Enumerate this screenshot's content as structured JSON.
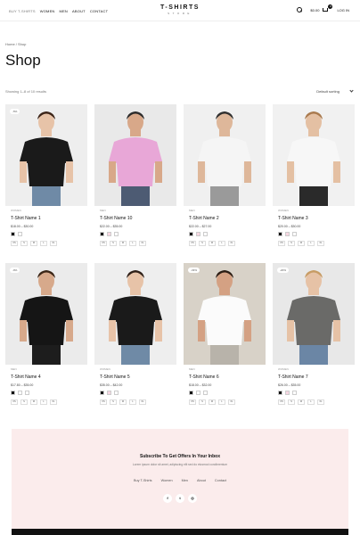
{
  "header": {
    "nav": [
      "BUY T-SHIRTS",
      "WOMEN",
      "MEN",
      "ABOUT",
      "CONTACT"
    ],
    "logo_main": "T-SHIRTS",
    "logo_sub": "STORE",
    "cart_total": "$0.00",
    "cart_count": "0",
    "login": "LOG IN"
  },
  "breadcrumb": "Home / Shop",
  "title": "Shop",
  "results": "Showing 1–8 of 10 results",
  "sort": "Default sorting",
  "products": [
    {
      "discount": "-5%",
      "category": "Women",
      "name": "T-Shirt Name 1",
      "price": "$18.00 – $30.00",
      "swatches": [
        "#111111",
        "#ffffff"
      ],
      "sizes": [
        "XS",
        "S",
        "M",
        "L",
        "XL"
      ],
      "bg": "#eeeeee",
      "shirt": "#1a1a1a",
      "skin": "#e7c3a8",
      "hair": "#3b2418",
      "legs": "#6f8aa6"
    },
    {
      "discount": "",
      "category": "Men",
      "name": "T-Shirt Name 10",
      "price": "$22.00 – $35.00",
      "swatches": [
        "#111111",
        "#f6d6e2",
        "#ffffff"
      ],
      "sizes": [
        "XS",
        "S",
        "M",
        "L",
        "XL"
      ],
      "bg": "#e9e9e9",
      "shirt": "#e8a7d7",
      "skin": "#d8a889",
      "hair": "#2b2b2b",
      "legs": "#4d5b73"
    },
    {
      "discount": "",
      "category": "Men",
      "name": "T-Shirt Name 2",
      "price": "$22.00 – $27.00",
      "swatches": [
        "#111111",
        "#f6d6e2",
        "#ffffff"
      ],
      "sizes": [
        "XS",
        "S",
        "M",
        "L",
        "XL"
      ],
      "bg": "#f0f0f0",
      "shirt": "#f5f5f5",
      "skin": "#deb79a",
      "hair": "#2f2f2f",
      "legs": "#9a9a9a"
    },
    {
      "discount": "",
      "category": "Women",
      "name": "T-Shirt Name 3",
      "price": "$20.00 – $30.00",
      "swatches": [
        "#111111",
        "#f6d6e2",
        "#ffffff"
      ],
      "sizes": [
        "XS",
        "S",
        "M",
        "L",
        "XL"
      ],
      "bg": "#f1f1f1",
      "shirt": "#f7f7f7",
      "skin": "#e4c0a3",
      "hair": "#a97a4e",
      "legs": "#2a2a2a"
    },
    {
      "discount": "-9%",
      "category": "Men",
      "name": "T-Shirt Name 4",
      "price": "$17.80 – $35.00",
      "swatches": [
        "#111111",
        "#ffffff",
        "#ffffff"
      ],
      "sizes": [
        "XS",
        "S",
        "M",
        "L",
        "XL"
      ],
      "bg": "#ebebeb",
      "shirt": "#151515",
      "skin": "#d7a98b",
      "hair": "#3a2516",
      "legs": "#1d1d1d"
    },
    {
      "discount": "",
      "category": "Women",
      "name": "T-Shirt Name 5",
      "price": "$35.00 – $42.00",
      "swatches": [
        "#111111",
        "#f6d6e2",
        "#ffffff"
      ],
      "sizes": [
        "XS",
        "S",
        "M",
        "L",
        "XL"
      ],
      "bg": "#eeeeee",
      "shirt": "#1a1a1a",
      "skin": "#e7c3a8",
      "hair": "#2e1f17",
      "legs": "#6f8aa6"
    },
    {
      "discount": "-33%",
      "category": "Men",
      "name": "T-Shirt Name 6",
      "price": "$18.00 – $32.00",
      "swatches": [
        "#111111",
        "#ffffff",
        "#ffffff"
      ],
      "sizes": [
        "XS",
        "S",
        "M",
        "L",
        "XL"
      ],
      "bg": "#d8d2c8",
      "shirt": "#fbfbfb",
      "skin": "#d4a183",
      "hair": "#2b1d14",
      "legs": "#b8b3aa"
    },
    {
      "discount": "-20%",
      "category": "Women",
      "name": "T-Shirt Name 7",
      "price": "$26.00 – $35.00",
      "swatches": [
        "#111111",
        "#f6d6e2",
        "#ffffff"
      ],
      "sizes": [
        "XS",
        "S",
        "M",
        "L",
        "XL"
      ],
      "bg": "#e8e8e8",
      "shirt": "#6a6a68",
      "skin": "#e6c2a6",
      "hair": "#c79c64",
      "legs": "#6b86a5"
    }
  ],
  "newsletter": {
    "title": "Subscribe To Get Offers In Your Inbox",
    "text": "Lorem ipsum dolor sit amet, adipiscing elit sed do eiusmod condimentum",
    "links": [
      "Buy T-Shirts",
      "Women",
      "Men",
      "About",
      "Contact"
    ],
    "socials": [
      "f",
      "t",
      "◎"
    ]
  }
}
